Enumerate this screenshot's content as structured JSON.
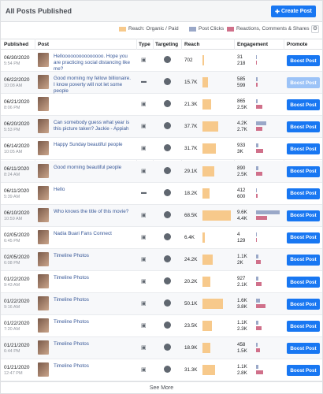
{
  "header": {
    "title": "All Posts Published",
    "create_label": "Create Post"
  },
  "legend": {
    "reach": "Reach: Organic / Paid",
    "clicks": "Post Clicks",
    "reactions": "Reactions, Comments & Shares",
    "colors": {
      "reach": "#f7c98b",
      "clicks": "#9aa8c8",
      "reactions": "#d0708a"
    }
  },
  "columns": {
    "published": "Published",
    "post": "Post",
    "type": "Type",
    "targeting": "Targeting",
    "reach": "Reach",
    "engagement": "Engagement",
    "promote": "Promote"
  },
  "rows": [
    {
      "date": "06/30/2020",
      "time": "5:54 PM",
      "post": "Hellooooooooooooooo. Hope you are practicing social distancing like me?",
      "type": "photo",
      "reach": "702",
      "reach_pct": 0.02,
      "clicks": "31",
      "reactions": "218",
      "clicks_pct": 0,
      "react_pct": 0,
      "boost": "Boost Post",
      "boost_disabled": false
    },
    {
      "date": "06/22/2020",
      "time": "10:08 AM",
      "post": "Good morning my fellow billionaire. I know poverty will not let some people",
      "type": "status",
      "reach": "15.7K",
      "reach_pct": 0.2,
      "clicks": "585",
      "reactions": "599",
      "clicks_pct": 0.06,
      "react_pct": 0.06,
      "boost": "Boost Post",
      "boost_disabled": true
    },
    {
      "date": "06/21/2020",
      "time": "8:06 PM",
      "post": "",
      "type": "photo",
      "reach": "21.3K",
      "reach_pct": 0.3,
      "clicks": "865",
      "reactions": "2.5K",
      "clicks_pct": 0.08,
      "react_pct": 0.25,
      "boost": "Boost Post",
      "boost_disabled": false
    },
    {
      "date": "06/20/2020",
      "time": "5:53 PM",
      "post": "Can somebody guess what year is this picture taken? Jackie - Appiah",
      "type": "photo",
      "reach": "37.7K",
      "reach_pct": 0.55,
      "clicks": "4.2K",
      "reactions": "2.7K",
      "clicks_pct": 0.42,
      "react_pct": 0.27,
      "boost": "Boost Post",
      "boost_disabled": false
    },
    {
      "date": "06/14/2020",
      "time": "10:05 AM",
      "post": "Happy Sunday beautiful people",
      "type": "photo",
      "reach": "31.7K",
      "reach_pct": 0.46,
      "clicks": "933",
      "reactions": "3K",
      "clicks_pct": 0.09,
      "react_pct": 0.3,
      "boost": "Boost Post",
      "boost_disabled": false
    },
    {
      "date": "06/11/2020",
      "time": "8:24 AM",
      "post": "Good morning beautiful people",
      "type": "photo",
      "reach": "29.1K",
      "reach_pct": 0.42,
      "clicks": "890",
      "reactions": "2.5K",
      "clicks_pct": 0.09,
      "react_pct": 0.25,
      "boost": "Boost Post",
      "boost_disabled": false
    },
    {
      "date": "06/11/2020",
      "time": "5:39 AM",
      "post": "Hello",
      "type": "status",
      "reach": "18.2K",
      "reach_pct": 0.26,
      "clicks": "412",
      "reactions": "600",
      "clicks_pct": 0.04,
      "react_pct": 0.06,
      "boost": "Boost Post",
      "boost_disabled": false
    },
    {
      "date": "06/10/2020",
      "time": "10:59 AM",
      "post": "Who knows the title of this movie?",
      "type": "photo",
      "reach": "68.5K",
      "reach_pct": 1.0,
      "clicks": "9.6K",
      "reactions": "4.4K",
      "clicks_pct": 0.96,
      "react_pct": 0.44,
      "boost": "Boost Post",
      "boost_disabled": false
    },
    {
      "date": "02/05/2020",
      "time": "6:45 PM",
      "post": "Nadia Buari Fans Connect",
      "type": "photo",
      "reach": "6.4K",
      "reach_pct": 0.07,
      "clicks": "4",
      "reactions": "129",
      "clicks_pct": 0,
      "react_pct": 0.01,
      "boost": "Boost Post",
      "boost_disabled": false
    },
    {
      "date": "02/05/2020",
      "time": "6:08 PM",
      "post": "Timeline Photos",
      "type": "photo",
      "reach": "24.2K",
      "reach_pct": 0.35,
      "clicks": "1.1K",
      "reactions": "2K",
      "clicks_pct": 0.11,
      "react_pct": 0.2,
      "boost": "Boost Post",
      "boost_disabled": false
    },
    {
      "date": "01/22/2020",
      "time": "9:43 AM",
      "post": "Timeline Photos",
      "type": "photo",
      "reach": "20.2K",
      "reach_pct": 0.29,
      "clicks": "927",
      "reactions": "2.1K",
      "clicks_pct": 0.09,
      "react_pct": 0.21,
      "boost": "Boost Post",
      "boost_disabled": false
    },
    {
      "date": "01/22/2020",
      "time": "9:16 AM",
      "post": "Timeline Photos",
      "type": "photo",
      "reach": "50.1K",
      "reach_pct": 0.73,
      "clicks": "1.6K",
      "reactions": "3.8K",
      "clicks_pct": 0.16,
      "react_pct": 0.38,
      "boost": "Boost Post",
      "boost_disabled": false
    },
    {
      "date": "01/22/2020",
      "time": "7:20 AM",
      "post": "Timeline Photos",
      "type": "photo",
      "reach": "23.5K",
      "reach_pct": 0.34,
      "clicks": "1.1K",
      "reactions": "2.3K",
      "clicks_pct": 0.11,
      "react_pct": 0.23,
      "boost": "Boost Post",
      "boost_disabled": false
    },
    {
      "date": "01/21/2020",
      "time": "6:44 PM",
      "post": "Timeline Photos",
      "type": "photo",
      "reach": "18.9K",
      "reach_pct": 0.27,
      "clicks": "458",
      "reactions": "1.5K",
      "clicks_pct": 0.05,
      "react_pct": 0.15,
      "boost": "Boost Post",
      "boost_disabled": false
    },
    {
      "date": "01/21/2020",
      "time": "12:47 PM",
      "post": "Timeline Photos",
      "type": "photo",
      "reach": "31.3K",
      "reach_pct": 0.45,
      "clicks": "1.1K",
      "reactions": "2.8K",
      "clicks_pct": 0.11,
      "react_pct": 0.28,
      "boost": "Boost Post",
      "boost_disabled": false
    }
  ],
  "footer": {
    "see_more": "See More"
  }
}
